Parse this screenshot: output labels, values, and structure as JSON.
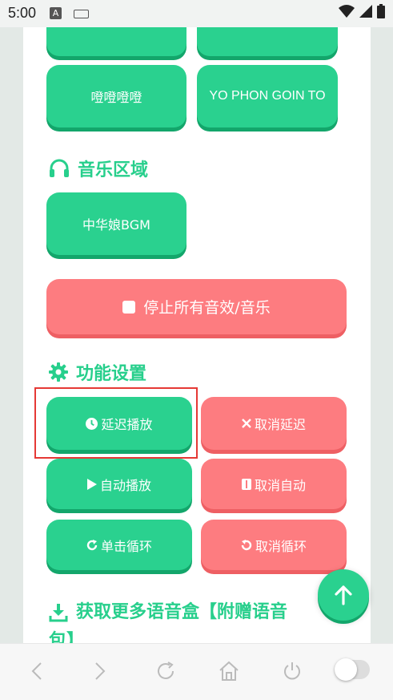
{
  "status_bar": {
    "time": "5:00",
    "notification_badge": "A"
  },
  "sound_buttons": {
    "row0": [
      "",
      ""
    ],
    "row1": [
      "噔噔噔噔",
      "YO PHON GOIN TO"
    ]
  },
  "music_section": {
    "title": "音乐区域",
    "icon": "headphones-icon",
    "buttons": [
      "中华娘BGM"
    ]
  },
  "stop_all": {
    "label": "停止所有音效/音乐",
    "icon": "stop-square-icon"
  },
  "function_section": {
    "title": "功能设置",
    "icon": "gear-icon",
    "buttons": [
      {
        "label": "延迟播放",
        "icon": "clock-icon",
        "color": "green"
      },
      {
        "label": "取消延迟",
        "icon": "close-x-icon",
        "color": "red"
      },
      {
        "label": "自动播放",
        "icon": "play-icon",
        "color": "green"
      },
      {
        "label": "取消自动",
        "icon": "pause-icon",
        "color": "red"
      },
      {
        "label": "单击循环",
        "icon": "redo-icon",
        "color": "green"
      },
      {
        "label": "取消循环",
        "icon": "undo-icon",
        "color": "red"
      }
    ]
  },
  "download_section": {
    "title_line1": "获取更多语音盒【附赠语音",
    "title_line2": "包】",
    "icon": "download-icon"
  },
  "colors": {
    "green": "#2ad18f",
    "green_dark": "#13a66b",
    "red": "#fd7c80",
    "red_dark": "#ee5f63",
    "accent_text": "#27cf8c",
    "highlight": "#e53935"
  }
}
